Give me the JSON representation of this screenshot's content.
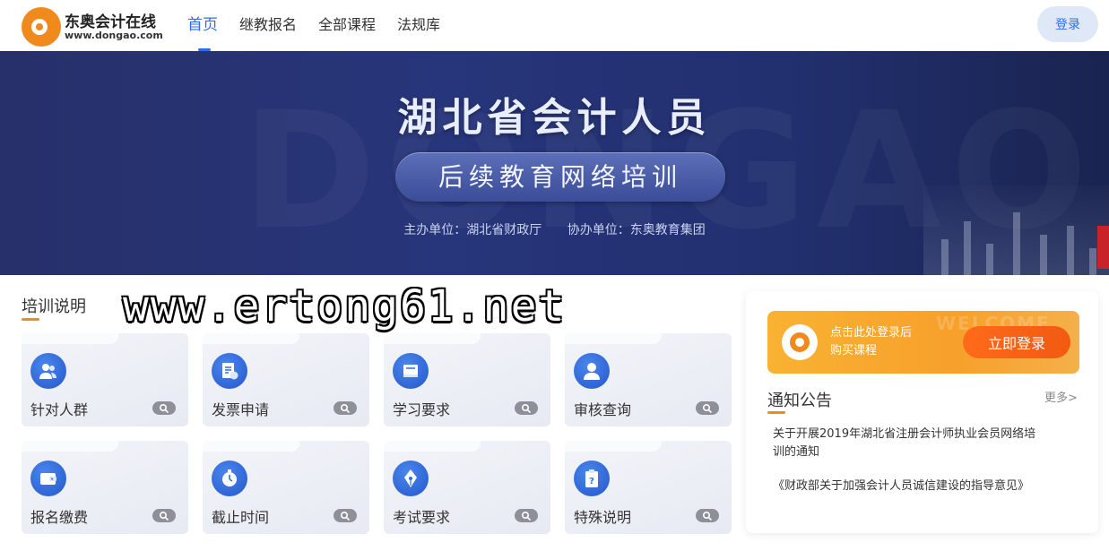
{
  "header": {
    "logo_name": "东奥会计在线",
    "logo_url": "www.dongao.com",
    "nav": [
      {
        "label": "首页",
        "active": true
      },
      {
        "label": "继教报名",
        "active": false
      },
      {
        "label": "全部课程",
        "active": false
      },
      {
        "label": "法规库",
        "active": false
      }
    ],
    "login_label": "登录"
  },
  "banner": {
    "title": "湖北省会计人员",
    "subtitle": "后续教育网络培训",
    "host": "主办单位：湖北省财政厅",
    "co_host": "协办单位：东奥教育集团"
  },
  "watermark": "www.ertong61.net",
  "training": {
    "title": "培训说明",
    "cards": [
      {
        "label": "针对人群",
        "icon": "people-icon"
      },
      {
        "label": "发票申请",
        "icon": "invoice-icon"
      },
      {
        "label": "学习要求",
        "icon": "book-icon"
      },
      {
        "label": "审核查询",
        "icon": "user-icon"
      },
      {
        "label": "报名缴费",
        "icon": "wallet-icon"
      },
      {
        "label": "截止时间",
        "icon": "stopwatch-icon"
      },
      {
        "label": "考试要求",
        "icon": "pen-icon"
      },
      {
        "label": "特殊说明",
        "icon": "clipboard-icon"
      }
    ]
  },
  "panel": {
    "promo_bg": "WELCOME",
    "promo_line1": "点击此处登录后",
    "promo_line2": "购买课程",
    "promo_button": "立即登录",
    "notice_title": "通知公告",
    "more_label": "更多>",
    "notices": [
      "关于开展2019年湖北省注册会计师执业会员网络培训的通知",
      "《财政部关于加强会计人员诚信建设的指导意见》"
    ]
  },
  "colors": {
    "brand_blue": "#2f6ee8",
    "brand_orange": "#f08a1d",
    "banner_bg": "#27306a",
    "promo_orange": "#f9b233",
    "promo_button": "#ff6a1a"
  }
}
